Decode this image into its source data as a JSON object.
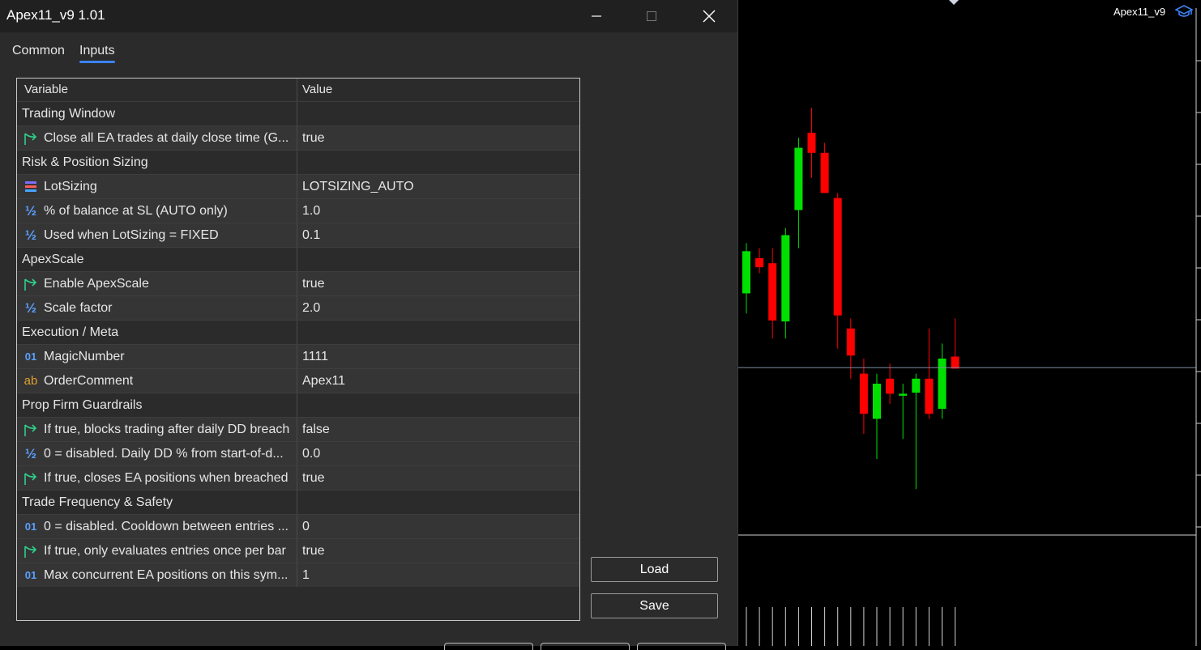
{
  "window": {
    "title": "Apex11_v9 1.01"
  },
  "tabs": [
    {
      "label": "Common",
      "active": false
    },
    {
      "label": "Inputs",
      "active": true
    }
  ],
  "grid": {
    "columns": {
      "variable": "Variable",
      "value": "Value"
    },
    "rows": [
      {
        "kind": "group",
        "variable": "Trading Window",
        "value": ""
      },
      {
        "kind": "param",
        "icon": "bool-arrow-icon",
        "variable": "Close all EA trades at daily close time (G...",
        "value": "true"
      },
      {
        "kind": "group",
        "variable": "Risk & Position Sizing",
        "value": ""
      },
      {
        "kind": "param",
        "icon": "enum-icon",
        "variable": "LotSizing",
        "value": "LOTSIZING_AUTO"
      },
      {
        "kind": "param",
        "icon": "double-icon",
        "variable": "% of balance at SL (AUTO only)",
        "value": "1.0"
      },
      {
        "kind": "param",
        "icon": "double-icon",
        "variable": "Used when LotSizing = FIXED",
        "value": "0.1"
      },
      {
        "kind": "group",
        "variable": "ApexScale",
        "value": ""
      },
      {
        "kind": "param",
        "icon": "bool-arrow-icon",
        "variable": "Enable ApexScale",
        "value": "true"
      },
      {
        "kind": "param",
        "icon": "double-icon",
        "variable": "Scale factor",
        "value": "2.0"
      },
      {
        "kind": "group",
        "variable": "Execution / Meta",
        "value": ""
      },
      {
        "kind": "param",
        "icon": "integer-icon",
        "variable": "MagicNumber",
        "value": "1111"
      },
      {
        "kind": "param",
        "icon": "string-icon",
        "variable": "OrderComment",
        "value": "Apex11"
      },
      {
        "kind": "group",
        "variable": "Prop Firm Guardrails",
        "value": ""
      },
      {
        "kind": "param",
        "icon": "bool-arrow-icon",
        "variable": "If true, blocks trading after daily DD breach",
        "value": "false"
      },
      {
        "kind": "param",
        "icon": "double-icon",
        "variable": "0 = disabled. Daily DD % from start-of-d...",
        "value": "0.0"
      },
      {
        "kind": "param",
        "icon": "bool-arrow-icon",
        "variable": "If true, closes EA positions when breached",
        "value": "true"
      },
      {
        "kind": "group",
        "variable": "Trade Frequency & Safety",
        "value": ""
      },
      {
        "kind": "param",
        "icon": "integer-icon",
        "variable": "0 = disabled. Cooldown between entries ...",
        "value": "0"
      },
      {
        "kind": "param",
        "icon": "bool-arrow-icon",
        "variable": "If true, only evaluates entries once per bar",
        "value": "true"
      },
      {
        "kind": "param",
        "icon": "integer-icon",
        "variable": "Max concurrent EA positions on this sym...",
        "value": "1"
      }
    ]
  },
  "icon_glyphs": {
    "double-icon": "½",
    "integer-icon": "01",
    "string-icon": "ab"
  },
  "buttons": {
    "load": "Load",
    "save": "Save"
  },
  "chart": {
    "label": "Apex11_v9",
    "bull_color": "#00e000",
    "bear_color": "#ff0000"
  },
  "chart_data": {
    "type": "candlestick",
    "candles": [
      {
        "o": 1.04,
        "h": 1.09,
        "l": 1.02,
        "c": 1.082
      },
      {
        "o": 1.075,
        "h": 1.085,
        "l": 1.06,
        "c": 1.066
      },
      {
        "o": 1.07,
        "h": 1.085,
        "l": 0.995,
        "c": 1.013
      },
      {
        "o": 1.012,
        "h": 1.105,
        "l": 0.995,
        "c": 1.098
      },
      {
        "o": 1.123,
        "h": 1.195,
        "l": 1.085,
        "c": 1.185
      },
      {
        "o": 1.2,
        "h": 1.225,
        "l": 1.155,
        "c": 1.18
      },
      {
        "o": 1.18,
        "h": 1.19,
        "l": 1.14,
        "c": 1.14
      },
      {
        "o": 1.135,
        "h": 1.14,
        "l": 0.985,
        "c": 1.018
      },
      {
        "o": 1.005,
        "h": 1.015,
        "l": 0.955,
        "c": 0.978
      },
      {
        "o": 0.96,
        "h": 0.975,
        "l": 0.9,
        "c": 0.92
      },
      {
        "o": 0.915,
        "h": 0.96,
        "l": 0.875,
        "c": 0.95
      },
      {
        "o": 0.955,
        "h": 0.97,
        "l": 0.93,
        "c": 0.94
      },
      {
        "o": 0.938,
        "h": 0.95,
        "l": 0.895,
        "c": 0.94
      },
      {
        "o": 0.941,
        "h": 0.96,
        "l": 0.845,
        "c": 0.955
      },
      {
        "o": 0.955,
        "h": 1.005,
        "l": 0.915,
        "c": 0.92
      },
      {
        "o": 0.925,
        "h": 0.99,
        "l": 0.915,
        "c": 0.975
      },
      {
        "o": 0.977,
        "h": 1.015,
        "l": 0.965,
        "c": 0.965
      }
    ],
    "price_line": 0.966,
    "ylim": [
      0.8,
      1.3
    ]
  }
}
